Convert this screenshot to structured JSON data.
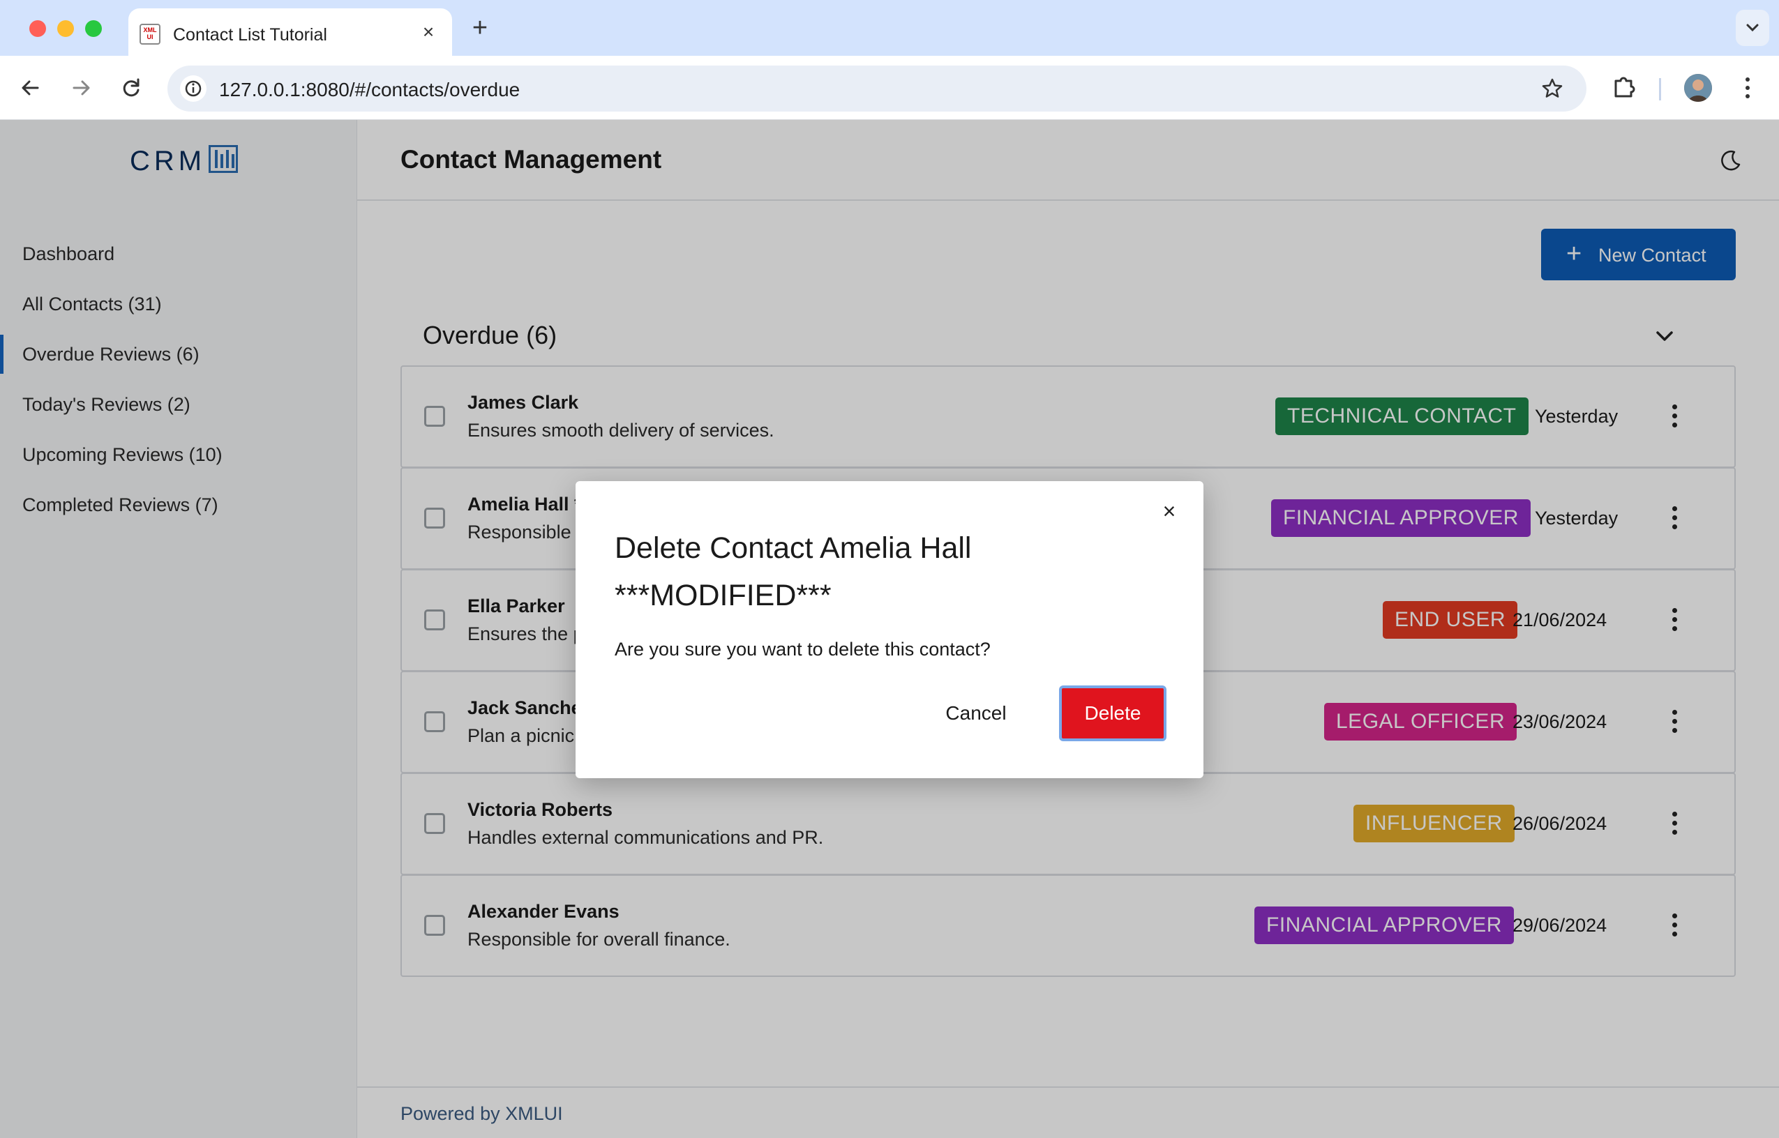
{
  "browser": {
    "tab_title": "Contact List Tutorial",
    "favicon_text": "XML UI",
    "url": "127.0.0.1:8080/#/contacts/overdue"
  },
  "sidebar": {
    "logo": "CRM",
    "items": [
      {
        "label": "Dashboard",
        "active": false
      },
      {
        "label": "All Contacts (31)",
        "active": false
      },
      {
        "label": "Overdue Reviews (6)",
        "active": true
      },
      {
        "label": "Today's Reviews (2)",
        "active": false
      },
      {
        "label": "Upcoming Reviews (10)",
        "active": false
      },
      {
        "label": "Completed Reviews (7)",
        "active": false
      }
    ]
  },
  "header": {
    "title": "Contact Management"
  },
  "actions": {
    "new_contact_label": "New Contact"
  },
  "group": {
    "title": "Overdue (6)"
  },
  "contacts": [
    {
      "name": "James Clark",
      "description": "Ensures smooth delivery of services.",
      "tag": "TECHNICAL CONTACT",
      "tag_color": "#1e8449",
      "date": "Yesterday"
    },
    {
      "name": "Amelia Hall *",
      "description": "Responsible",
      "tag": "FINANCIAL APPROVER",
      "tag_color": "#8e2fc4",
      "date": "Yesterday"
    },
    {
      "name": "Ella Parker",
      "description": "Ensures the p",
      "tag": "END USER",
      "tag_color": "#e23a22",
      "date": "21/06/2024"
    },
    {
      "name": "Jack Sanche",
      "description": "Plan a picnic",
      "tag": "LEGAL OFFICER",
      "tag_color": "#d4258a",
      "date": "23/06/2024"
    },
    {
      "name": "Victoria Roberts",
      "description": "Handles external communications and PR.",
      "tag": "INFLUENCER",
      "tag_color": "#e0a92a",
      "date": "26/06/2024"
    },
    {
      "name": "Alexander Evans",
      "description": "Responsible for overall finance.",
      "tag": "FINANCIAL APPROVER",
      "tag_color": "#8e2fc4",
      "date": "29/06/2024"
    }
  ],
  "footer": {
    "text": "Powered by XMLUI"
  },
  "dialog": {
    "close_glyph": "×",
    "title": "Delete Contact Amelia Hall ***MODIFIED***",
    "message": "Are you sure you want to delete this contact?",
    "cancel_label": "Cancel",
    "delete_label": "Delete"
  },
  "colors": {
    "primary": "#0d5bb5",
    "danger": "#e0141e"
  }
}
